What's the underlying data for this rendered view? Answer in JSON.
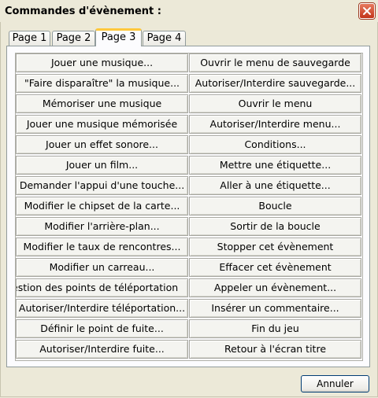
{
  "window": {
    "title": "Commandes d'évènement :"
  },
  "tabs": [
    {
      "label": "Page 1",
      "active": false
    },
    {
      "label": "Page 2",
      "active": false
    },
    {
      "label": "Page 3",
      "active": true
    },
    {
      "label": "Page 4",
      "active": false
    }
  ],
  "commands": {
    "left": [
      "Jouer une musique...",
      "\"Faire disparaître\" la musique...",
      "Mémoriser une musique",
      "Jouer une musique mémorisée",
      "Jouer un effet sonore...",
      "Jouer un film...",
      "Demander l'appui d'une touche...",
      "Modifier le chipset de la carte...",
      "Modifier l'arrière-plan...",
      "Modifier le taux de rencontres...",
      "Modifier un carreau...",
      "estion des points de téléportation",
      "Autoriser/Interdire téléportation...",
      "Définir le point de fuite...",
      "Autoriser/Interdire fuite..."
    ],
    "right": [
      "Ouvrir le menu de sauvegarde",
      "Autoriser/Interdire sauvegarde...",
      "Ouvrir le menu",
      "Autoriser/Interdire menu...",
      "Conditions...",
      "Mettre une étiquette...",
      "Aller à une étiquette...",
      "Boucle",
      "Sortir de la boucle",
      "Stopper cet évènement",
      "Effacer cet évènement",
      "Appeler un évènement...",
      "Insérer un commentaire...",
      "Fin du jeu",
      "Retour à l'écran titre"
    ]
  },
  "buttons": {
    "cancel": "Annuler"
  }
}
